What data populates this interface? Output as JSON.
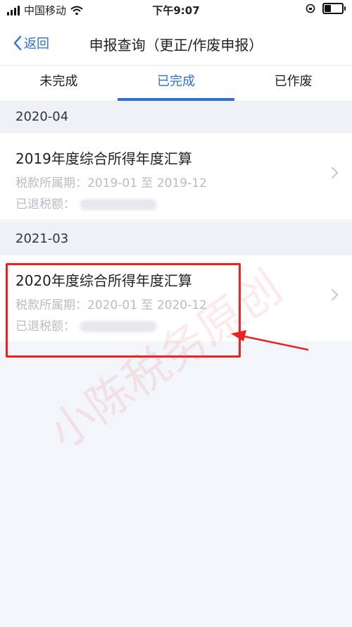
{
  "status_bar": {
    "carrier": "中国移动",
    "time": "下午9:07"
  },
  "nav": {
    "back_label": "返回",
    "title": "申报查询（更正/作废申报）"
  },
  "tabs": [
    {
      "label": "未完成",
      "active": false
    },
    {
      "label": "已完成",
      "active": true
    },
    {
      "label": "已作废",
      "active": false
    }
  ],
  "groups": [
    {
      "date": "2020-04",
      "item": {
        "title": "2019年度综合所得年度汇算",
        "period": "税款所属期：2019-01 至 2019-12",
        "refund_label": "已退税额："
      }
    },
    {
      "date": "2021-03",
      "item": {
        "title": "2020年度综合所得年度汇算",
        "period": "税款所属期：2020-01 至 2020-12",
        "refund_label": "已退税额："
      }
    }
  ],
  "watermark": "小陈税务原创",
  "colors": {
    "accent": "#2b6fe0",
    "highlight": "#ec2222",
    "background": "#f2f5f9"
  }
}
